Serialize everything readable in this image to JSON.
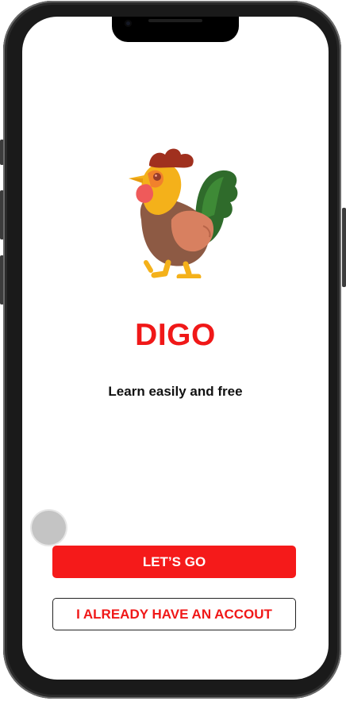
{
  "app": {
    "title": "DIGO",
    "tagline": "Learn easily and free",
    "mascot": "rooster-icon"
  },
  "buttons": {
    "primary_label": "LET’S GO",
    "secondary_label": "I ALREADY HAVE AN ACCOUT"
  },
  "colors": {
    "accent": "#f01818",
    "primary_button": "#f51a1a",
    "background": "#ffffff"
  }
}
